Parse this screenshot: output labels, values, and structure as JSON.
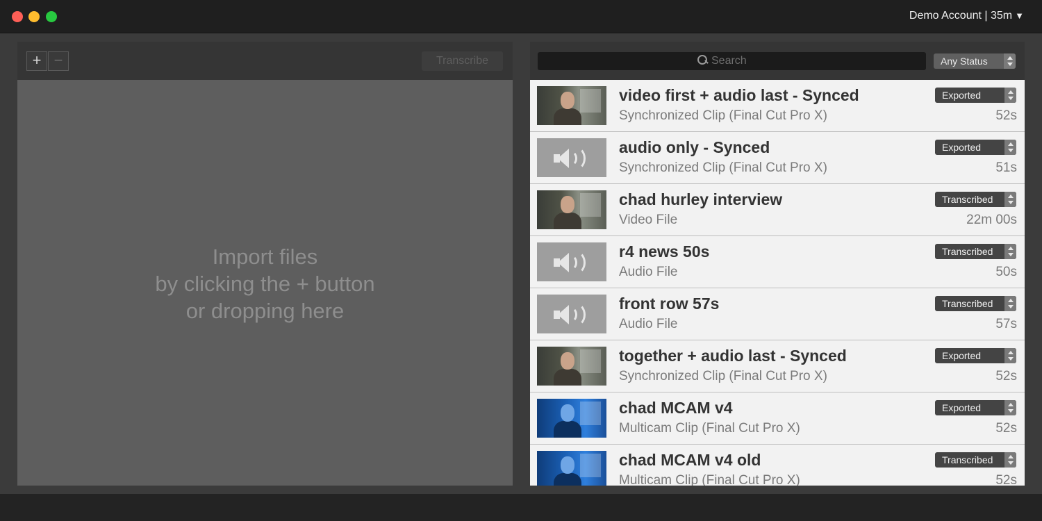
{
  "account": {
    "label": "Demo Account | 35m",
    "menu_icon": "triangle-down-icon"
  },
  "left": {
    "add_label": "+",
    "remove_label": "−",
    "transcribe_label": "Transcribe",
    "drop_lines": [
      "Import files",
      "by clicking the + button",
      "or dropping here"
    ]
  },
  "right": {
    "search_placeholder": "Search",
    "status_filter": "Any Status",
    "items": [
      {
        "title": "video first + audio last - Synced",
        "subtitle": "Synchronized Clip (Final Cut Pro X)",
        "duration": "52s",
        "status": "Exported",
        "thumb": "video"
      },
      {
        "title": "audio only - Synced",
        "subtitle": "Synchronized Clip (Final Cut Pro X)",
        "duration": "51s",
        "status": "Exported",
        "thumb": "audio"
      },
      {
        "title": "chad hurley interview",
        "subtitle": "Video File",
        "duration": "22m 00s",
        "status": "Transcribed",
        "thumb": "video"
      },
      {
        "title": "r4 news 50s",
        "subtitle": "Audio File",
        "duration": "50s",
        "status": "Transcribed",
        "thumb": "audio"
      },
      {
        "title": "front row 57s",
        "subtitle": "Audio File",
        "duration": "57s",
        "status": "Transcribed",
        "thumb": "audio"
      },
      {
        "title": "together + audio last - Synced",
        "subtitle": "Synchronized Clip (Final Cut Pro X)",
        "duration": "52s",
        "status": "Exported",
        "thumb": "video"
      },
      {
        "title": "chad MCAM v4",
        "subtitle": "Multicam Clip (Final Cut Pro X)",
        "duration": "52s",
        "status": "Exported",
        "thumb": "blue"
      },
      {
        "title": "chad MCAM v4 old",
        "subtitle": "Multicam Clip (Final Cut Pro X)",
        "duration": "52s",
        "status": "Transcribed",
        "thumb": "blue"
      }
    ]
  }
}
